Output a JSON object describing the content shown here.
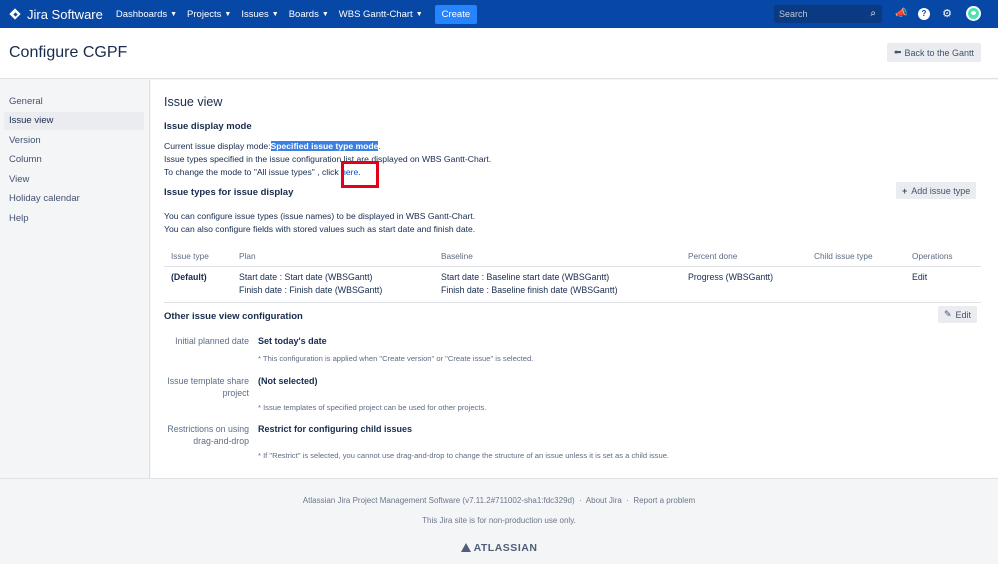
{
  "nav": {
    "product": "Jira Software",
    "items": [
      {
        "label": "Dashboards"
      },
      {
        "label": "Projects"
      },
      {
        "label": "Issues"
      },
      {
        "label": "Boards"
      },
      {
        "label": "WBS Gantt-Chart"
      }
    ],
    "create_label": "Create",
    "search_placeholder": "Search"
  },
  "header": {
    "title": "Configure CGPF",
    "back_label": "Back to the Gantt"
  },
  "sidebar": {
    "items": [
      {
        "label": "General"
      },
      {
        "label": "Issue view"
      },
      {
        "label": "Version"
      },
      {
        "label": "Column"
      },
      {
        "label": "View"
      },
      {
        "label": "Holiday calendar"
      },
      {
        "label": "Help"
      }
    ],
    "active": "Issue view"
  },
  "main": {
    "title": "Issue view",
    "display_mode": {
      "heading": "Issue display mode",
      "current_prefix": "Current issue display mode:",
      "current_value": "Specified issue type mode",
      "current_suffix": ".",
      "line2": "Issue types specified in the issue configuration list are displayed on WBS Gantt-Chart.",
      "line3_prefix": "To change the mode to \"All issue types\" , click ",
      "line3_link": "here",
      "line3_suffix": "."
    },
    "issue_types": {
      "heading": "Issue types for issue display",
      "add_label": "Add issue type",
      "desc1": "You can configure issue types (issue names) to be displayed in WBS Gantt-Chart.",
      "desc2": "You can also configure fields with stored values such as start date and finish date.",
      "columns": [
        "Issue type",
        "Plan",
        "Baseline",
        "Percent done",
        "Child issue type",
        "Operations"
      ],
      "rows": [
        {
          "issue_type": "(Default)",
          "plan_start": "Start date : Start date (WBSGantt)",
          "plan_finish": "Finish date : Finish date (WBSGantt)",
          "baseline_start": "Start date : Baseline start date (WBSGantt)",
          "baseline_finish": "Finish date : Baseline finish date (WBSGantt)",
          "percent_done": "Progress (WBSGantt)",
          "child_issue_type": "",
          "operation": "Edit"
        }
      ]
    },
    "other": {
      "heading": "Other issue view configuration",
      "edit_label": "Edit",
      "rows": [
        {
          "label": "Initial planned date",
          "value": "Set today's date",
          "note": "* This configuration is applied when \"Create version\" or \"Create issue\" is selected."
        },
        {
          "label": "Issue template share project",
          "value": "(Not selected)",
          "note": "* Issue templates of specified project can be used for other projects."
        },
        {
          "label": "Restrictions on using drag-and-drop",
          "value": "Restrict for configuring child issues",
          "note": "* If \"Restrict\" is selected, you cannot use drag-and-drop to change the structure of an issue unless it is set as a child issue."
        }
      ]
    }
  },
  "footer": {
    "version_text": "Atlassian Jira Project Management Software (v7.11.2#711002-sha1:fdc329d)",
    "sep": "·",
    "about": "About Jira",
    "report": "Report a problem",
    "nonprod": "This Jira site is for non-production use only.",
    "brand": "ATLASSIAN"
  },
  "colors": {
    "nav_bg": "#0747A6",
    "link": "#0052CC",
    "highlight_box": "#E3001B"
  }
}
